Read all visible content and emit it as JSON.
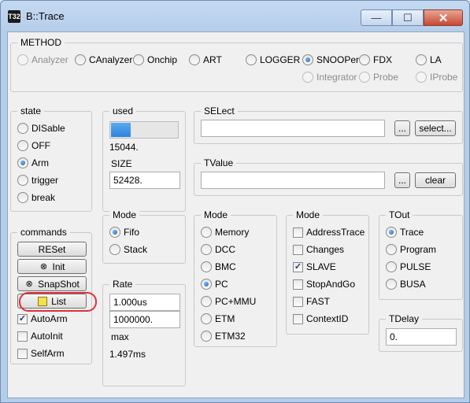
{
  "window": {
    "title": "B::Trace",
    "icon_text": "T32",
    "min_symbol": "—",
    "max_symbol": "☐",
    "close_symbol": "✕"
  },
  "method": {
    "label": "METHOD",
    "options": [
      "Analyzer",
      "CAnalyzer",
      "Onchip",
      "ART",
      "LOGGER",
      "SNOOPer",
      "FDX",
      "LA",
      "Integrator",
      "Probe",
      "IProbe"
    ],
    "selected": "SNOOPer"
  },
  "state": {
    "label": "state",
    "options": [
      "DISable",
      "OFF",
      "Arm",
      "trigger",
      "break"
    ],
    "selected": "Arm"
  },
  "used": {
    "label": "used",
    "progress": 0.29,
    "value": "15044."
  },
  "size": {
    "label": "SIZE",
    "value": "52428."
  },
  "select": {
    "label": "SELect",
    "value": "",
    "dots": "...",
    "button": "select..."
  },
  "tvalue": {
    "label": "TValue",
    "value": "",
    "dots": "...",
    "button": "clear"
  },
  "commands": {
    "label": "commands",
    "buttons": [
      "RESet",
      "Init",
      "SnapShot",
      "List"
    ],
    "checks": [
      {
        "label": "AutoArm",
        "checked": true
      },
      {
        "label": "AutoInit",
        "checked": false
      },
      {
        "label": "SelfArm",
        "checked": false
      }
    ]
  },
  "mode1": {
    "label": "Mode",
    "options": [
      "Fifo",
      "Stack"
    ],
    "selected": "Fifo"
  },
  "rate": {
    "label": "Rate",
    "value1": "1.000us",
    "value2": "1000000.",
    "max_label": "max",
    "max_value": "1.497ms"
  },
  "mode2": {
    "label": "Mode",
    "options": [
      "Memory",
      "DCC",
      "BMC",
      "PC",
      "PC+MMU",
      "ETM",
      "ETM32"
    ],
    "selected": "PC"
  },
  "mode3": {
    "label": "Mode",
    "checks": [
      {
        "label": "AddressTrace",
        "checked": false
      },
      {
        "label": "Changes",
        "checked": false
      },
      {
        "label": "SLAVE",
        "checked": true
      },
      {
        "label": "StopAndGo",
        "checked": false
      },
      {
        "label": "FAST",
        "checked": false
      },
      {
        "label": "ContextID",
        "checked": false
      }
    ]
  },
  "tout": {
    "label": "TOut",
    "options": [
      "Trace",
      "Program",
      "PULSE",
      "BUSA"
    ],
    "selected": "Trace"
  },
  "tdelay": {
    "label": "TDelay",
    "value": "0."
  }
}
